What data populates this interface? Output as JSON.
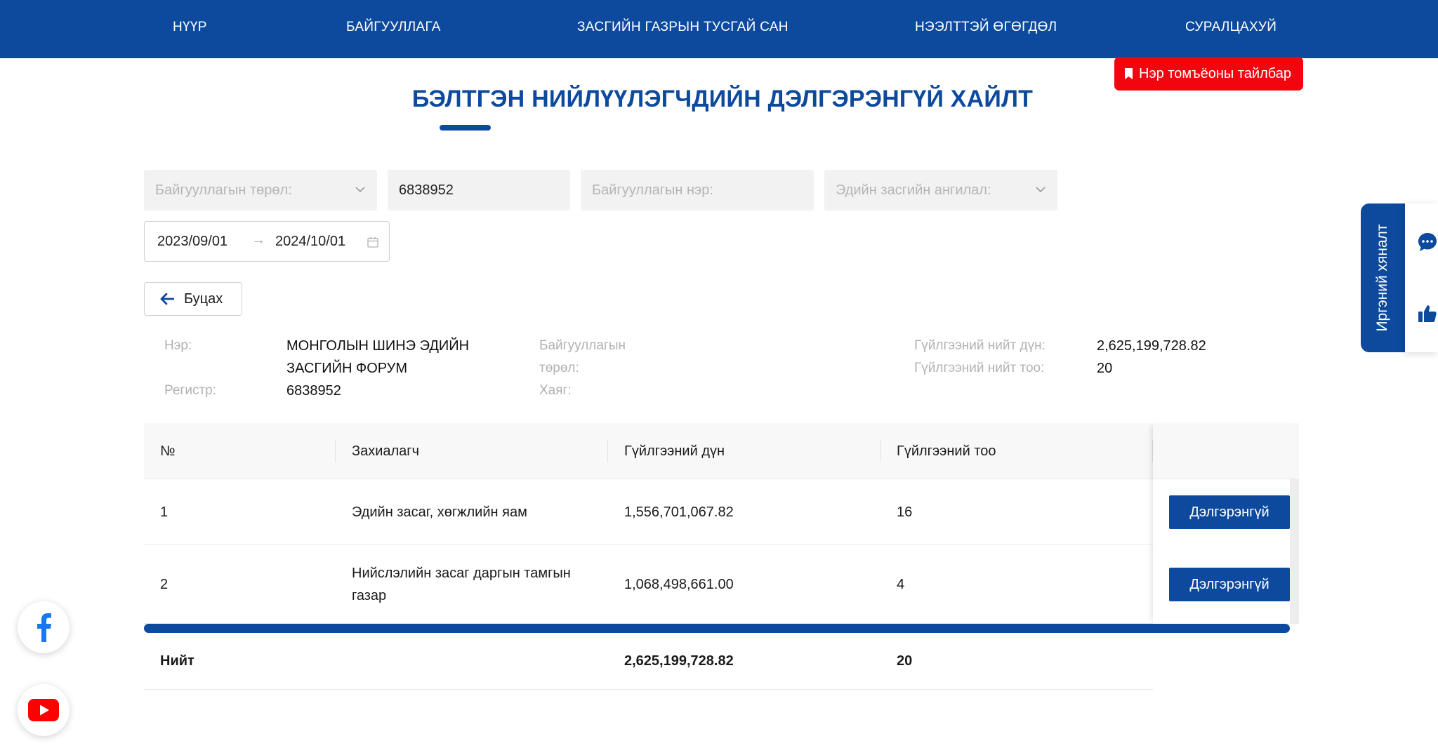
{
  "nav": {
    "items": [
      "НҮҮР",
      "БАЙГУУЛЛАГА",
      "ЗАСГИЙН ГАЗРЫН ТУСГАЙ САН",
      "НЭЭЛТТЭЙ ӨГӨГДӨЛ",
      "СУРАЛЦАХУЙ"
    ]
  },
  "legend_button": "Нэр томъёоны тайлбар",
  "page_title": "БЭЛТГЭН НИЙЛҮҮЛЭГЧДИЙН ДЭЛГЭРЭНГҮЙ ХАЙЛТ",
  "filters": {
    "org_type_placeholder": "Байгууллагын төрөл:",
    "register_value": "6838952",
    "org_name_placeholder": "Байгууллагын нэр:",
    "econ_class_placeholder": "Эдийн засгийн ангилал:",
    "date_from": "2023/09/01",
    "date_to": "2024/10/01"
  },
  "back_button": "Буцах",
  "info": {
    "name_label": "Нэр:",
    "name_value_line1": "МОНГОЛЫН ШИНЭ ЭДИЙН",
    "name_value_line2": "ЗАСГИЙН ФОРУМ",
    "register_label": "Регистр:",
    "register_value": "6838952",
    "org_type_label_line1": "Байгууллагын",
    "org_type_label_line2": "төрөл:",
    "address_label": "Хаяг:",
    "total_amount_label": "Гүйлгээний нийт дүн:",
    "total_amount_value": "2,625,199,728.82",
    "total_count_label": "Гүйлгээний нийт тоо:",
    "total_count_value": "20"
  },
  "table": {
    "headers": [
      "№",
      "Захиалагч",
      "Гүйлгээний дүн",
      "Гүйлгээний тоо"
    ],
    "rows": [
      {
        "no": "1",
        "customer_line1": "Эдийн засаг, хөгжлийн яам",
        "customer_line2": "",
        "amount": "1,556,701,067.82",
        "count": "16",
        "action": "Дэлгэрэнгүй"
      },
      {
        "no": "2",
        "customer_line1": "Нийслэлийн засаг даргын тамгын",
        "customer_line2": "газар",
        "amount": "1,068,498,661.00",
        "count": "4",
        "action": "Дэлгэрэнгүй"
      }
    ],
    "total": {
      "label": "Нийт",
      "amount": "2,625,199,728.82",
      "count": "20"
    }
  },
  "feedback_tab": "Иргэний хяналт",
  "icons": {
    "chevron": "chevron-down-icon",
    "calendar": "calendar-icon",
    "back_arrow": "arrow-left-icon",
    "bookmark": "bookmark-icon",
    "chat": "chat-icon",
    "like": "thumbs-up-icon",
    "facebook": "facebook-icon",
    "youtube": "youtube-icon"
  },
  "colors": {
    "primary": "#0d4a9e",
    "legend_red": "#f2050f",
    "facebook": "#1877f2",
    "youtube": "#ff0000"
  }
}
